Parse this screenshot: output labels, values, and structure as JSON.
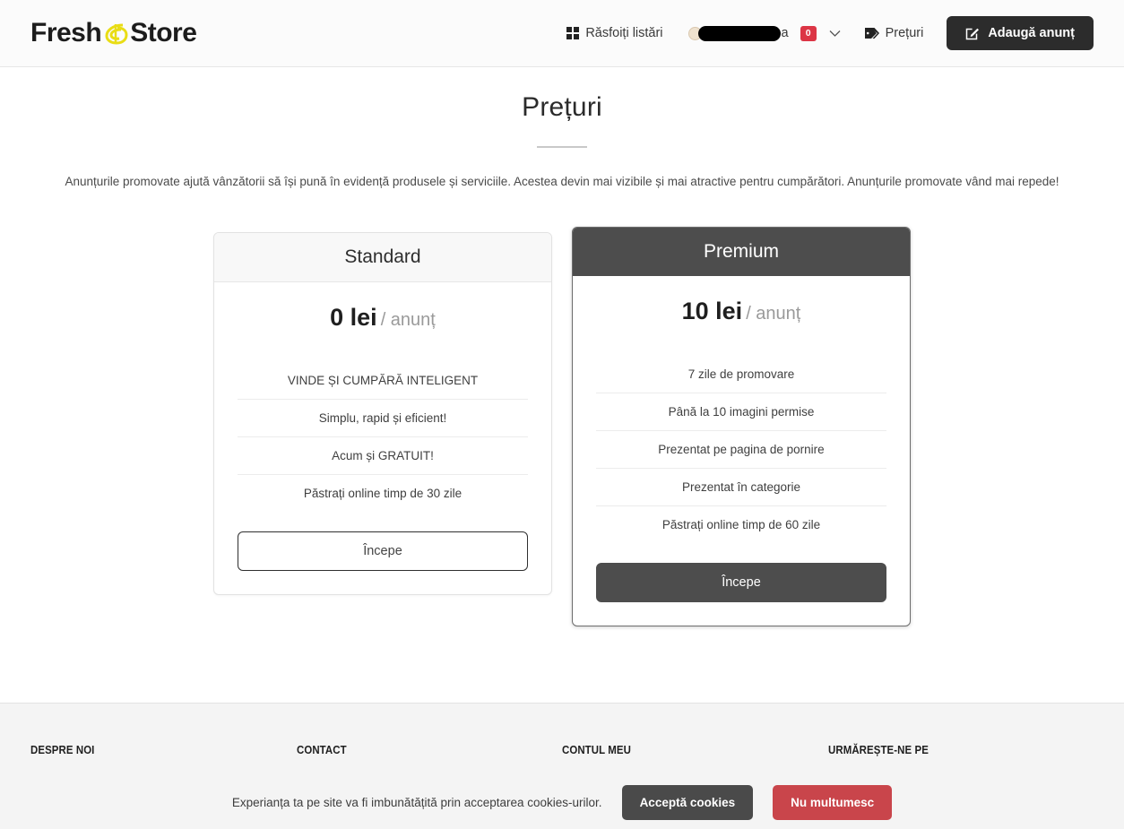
{
  "header": {
    "brand_first": "Fresh",
    "brand_second": "Store",
    "brand_icon": "leaf-s-logo-icon",
    "nav": {
      "browse_label": "Răsfoiți listări",
      "browse_icon": "grid-icon",
      "prices_label": "Prețuri",
      "prices_icon": "price-tag-icon",
      "add_label": "Adaugă anunț",
      "add_icon": "edit-square-icon"
    },
    "user": {
      "name_visible_tail": "a",
      "name_redacted": true,
      "badge_count": "0",
      "avatar_icon": "user-avatar-icon",
      "chevron_icon": "chevron-down-icon"
    }
  },
  "main": {
    "title": "Prețuri",
    "lead": "Anunțurile promovate ajută vânzătorii să își pună în evidență produsele și serviciile. Acestea devin mai vizibile și mai atractive pentru cumpărători. Anunțurile promovate vând mai repede!",
    "plans": [
      {
        "name": "Standard",
        "price_amount": "0 lei",
        "price_unit": "/ anunț",
        "features": [
          "VINDE ȘI CUMPĂRĂ INTELIGENT",
          "Simplu, rapid și eficient!",
          "Acum și GRATUIT!",
          "Păstrați online timp de 30 zile"
        ],
        "cta": "Începe"
      },
      {
        "name": "Premium",
        "price_amount": "10 lei",
        "price_unit": "/ anunț",
        "features": [
          "7 zile de promovare",
          "Până la 10 imagini permise",
          "Prezentat pe pagina de pornire",
          "Prezentat în categorie",
          "Păstrați online timp de 60 zile"
        ],
        "cta": "Începe"
      }
    ]
  },
  "footer": {
    "columns": [
      {
        "heading": "DESPRE NOI"
      },
      {
        "heading": "CONTACT"
      },
      {
        "heading": "CONTUL MEU"
      },
      {
        "heading": "URMĂREȘTE-NE PE"
      }
    ]
  },
  "cookies": {
    "text": "Experianța ta pe site va fi imbunătățită prin acceptarea cookies-urilor.",
    "accept_label": "Acceptă cookies",
    "decline_label": "Nu multumesc"
  },
  "colors": {
    "accent_dark": "#4d4d4d",
    "brand_yellow": "#e9dd15",
    "badge_red": "#dc3545",
    "decline_red": "#c9454b"
  }
}
